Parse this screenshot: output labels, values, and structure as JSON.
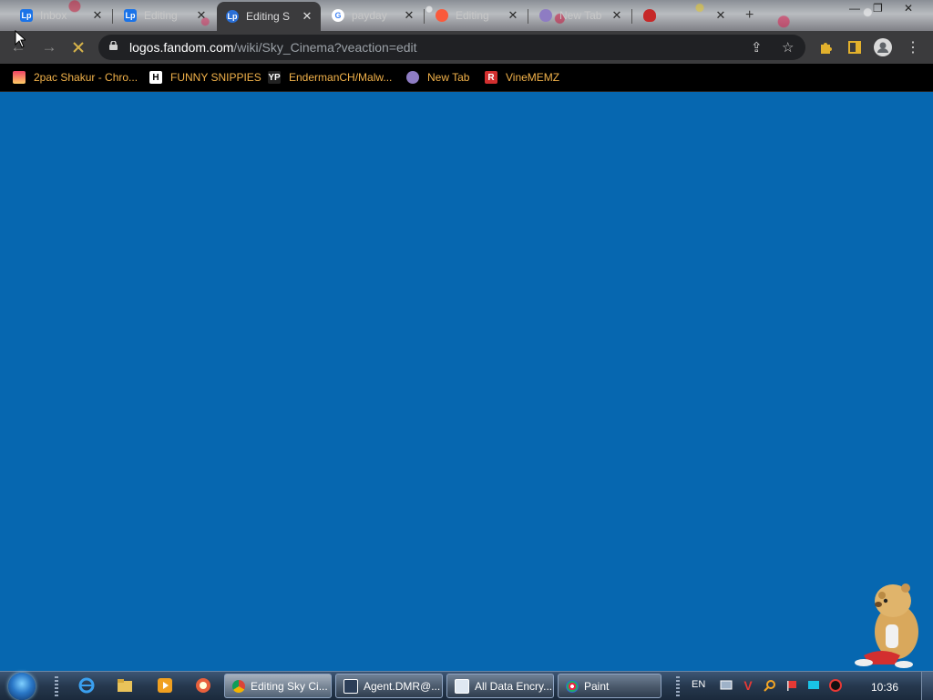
{
  "tabs": [
    {
      "title": "Inbox",
      "favicon": "lp-icon",
      "active": false
    },
    {
      "title": "Editing",
      "favicon": "lp-icon",
      "active": false
    },
    {
      "title": "Editing S",
      "favicon": "lp-icon",
      "active": true
    },
    {
      "title": "payday",
      "favicon": "google-icon",
      "active": false
    },
    {
      "title": "Editing",
      "favicon": "fandom-icon",
      "active": false
    },
    {
      "title": "New Tab",
      "favicon": "globe-icon",
      "active": false
    },
    {
      "title": "",
      "favicon": "shield-icon",
      "active": false
    }
  ],
  "toolbar": {
    "url_host": "logos.fandom.com",
    "url_path": "/wiki/Sky_Cinema?veaction=edit",
    "stop_icon": "stop-loading-icon"
  },
  "bookmarks": [
    {
      "label": "2pac Shakur - Chro...",
      "icon": "photo-icon"
    },
    {
      "label": "FUNNY SNIPPIES",
      "icon": "h-icon"
    },
    {
      "label": "EndermanCH/Malw...",
      "icon": "yp-icon"
    },
    {
      "label": "New Tab",
      "icon": "globe-icon"
    },
    {
      "label": "VineMEMZ",
      "icon": "r-icon"
    }
  ],
  "taskbar": {
    "items": [
      {
        "label": "Editing Sky Ci...",
        "icon": "chrome-icon",
        "active": true
      },
      {
        "label": "Agent.DMR@...",
        "icon": "window-icon",
        "active": false
      },
      {
        "label": "All Data Encry...",
        "icon": "window-icon",
        "active": false
      },
      {
        "label": "Paint",
        "icon": "paint-icon",
        "active": false
      }
    ],
    "language": "EN",
    "clock": "10:36"
  },
  "colors": {
    "page_background": "#0667b0",
    "bookmark_text": "#f2b24a",
    "toolbar": "#3b3b3d"
  }
}
